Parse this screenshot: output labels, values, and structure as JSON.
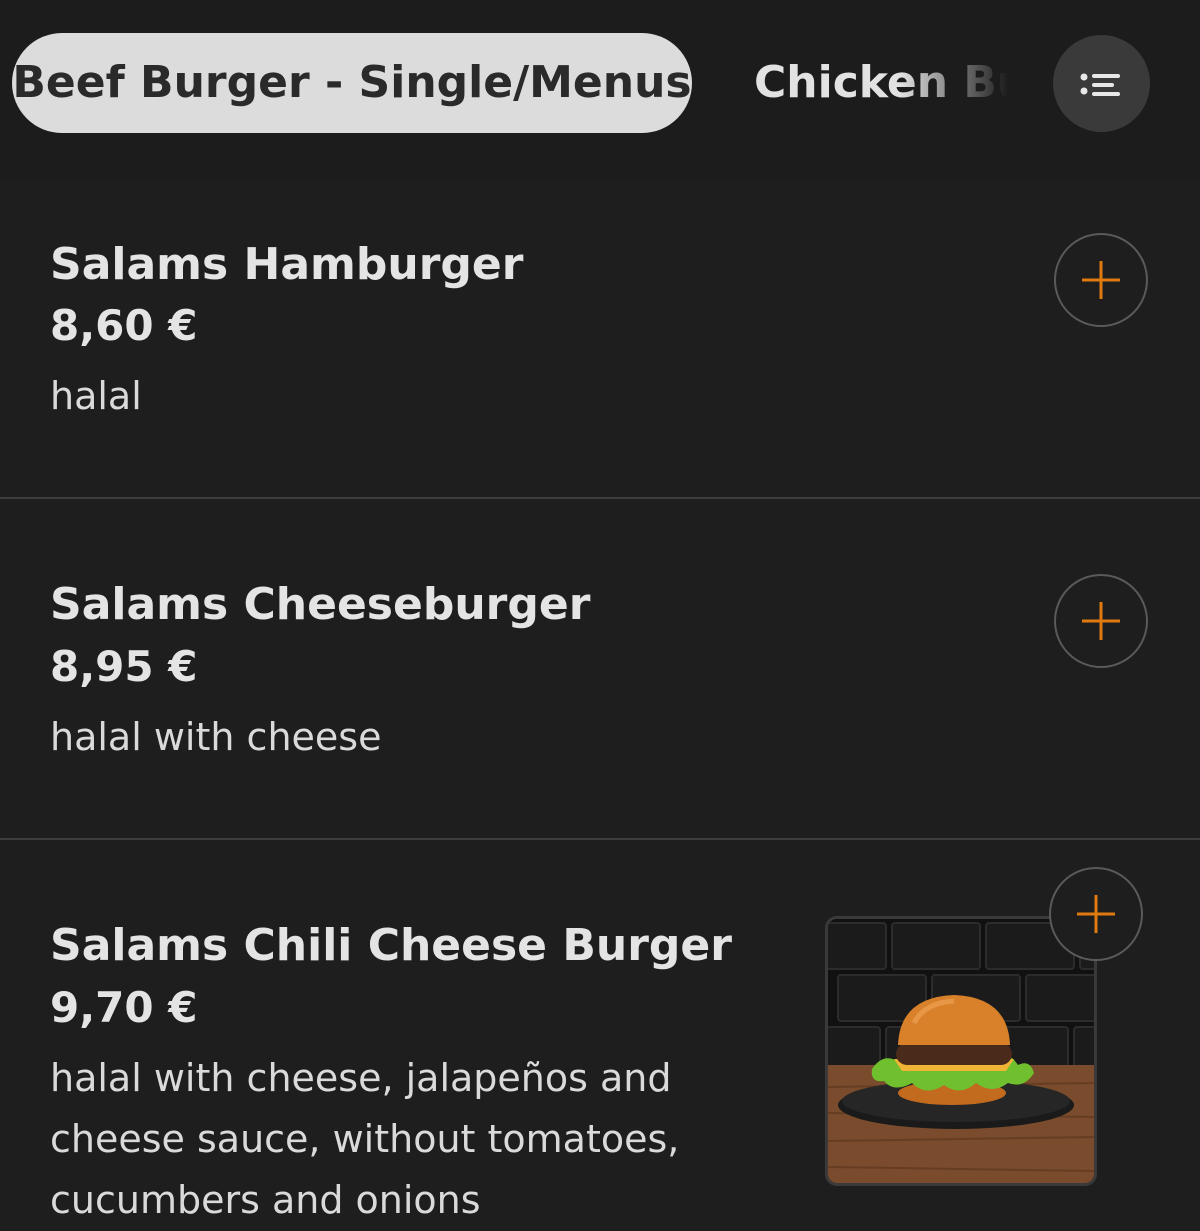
{
  "category_tabs": {
    "active_label": "Beef Burger - Single/Menus",
    "next_label": "Chicken Burger",
    "list_button_icon": "list-icon"
  },
  "menu_items": [
    {
      "name": "Salams Hamburger",
      "price": "8,60 €",
      "description": "halal",
      "add_icon": "plus-icon",
      "has_image": false
    },
    {
      "name": "Salams Cheeseburger",
      "price": "8,95 €",
      "description": "halal with cheese",
      "add_icon": "plus-icon",
      "has_image": false
    },
    {
      "name": "Salams Chili Cheese Burger",
      "price": "9,70 €",
      "description": "halal with cheese, jalapeños and cheese sauce, without tomatoes, cucumbers and onions",
      "add_icon": "plus-icon",
      "has_image": true
    }
  ],
  "colors": {
    "background": "#1e1e1e",
    "accent": "#e07a10",
    "active_tab_bg": "#dcdcdc",
    "text": "#e4e4e4"
  }
}
